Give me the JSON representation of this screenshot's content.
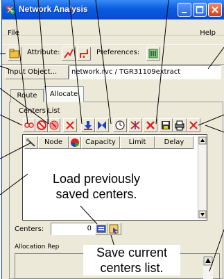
{
  "window": {
    "title": "Network Analysis"
  },
  "menu": {
    "file": "File",
    "help": "Help"
  },
  "toolbar": {
    "attribute_label": "Attribute:",
    "preferences_label": "Preferences:"
  },
  "input": {
    "button_label": "Input Object...",
    "value": "network.rvc / TGR31109extract"
  },
  "tabs": [
    {
      "label": "Route"
    },
    {
      "label": "Allocate"
    }
  ],
  "centers": {
    "list_label": "Centers List",
    "columns": [
      "Node",
      "Capacity",
      "Limit",
      "Delay"
    ],
    "count_label": "Centers:",
    "count_value": "0"
  },
  "allocation": {
    "label": "Allocation Rep"
  },
  "callouts": {
    "load": [
      "Load previously",
      "saved centers."
    ],
    "save": [
      "Save current",
      "centers list."
    ]
  }
}
